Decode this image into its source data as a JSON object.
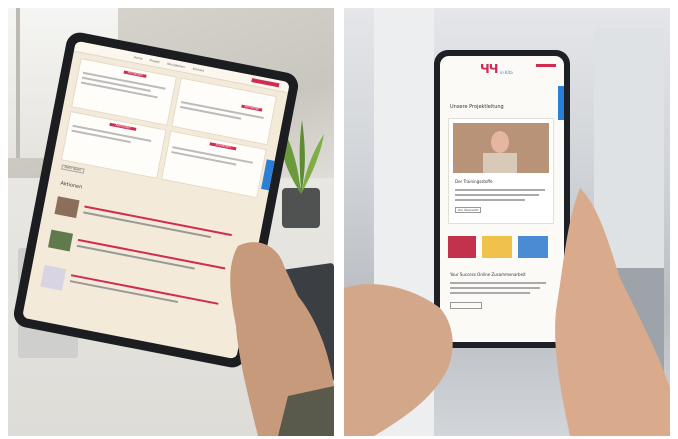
{
  "left_photo": {
    "tablet": {
      "nav_items": [
        "Home",
        "Projekt",
        "Neuigkeiten",
        "Kontakt"
      ],
      "section_title": "Aktionen",
      "card_buttons": [
        "Anmelden",
        "Anmelden",
        "Anmelden",
        "Anmelden"
      ],
      "more_button": "Mehr lesen"
    }
  },
  "right_photo": {
    "phone": {
      "logo_text": "ЧЧ",
      "logo_subtitle": "in Kita",
      "heading": "Unsere Projektleitung",
      "card_title": "Der Trainingsstoffe",
      "button_label": "Zur Übersicht",
      "section2_title": "Your Success Online Zusammenarbeit"
    }
  },
  "colors": {
    "brand_red": "#d12b52",
    "accent_blue": "#2a7fd6",
    "device_dark": "#1b1d20"
  }
}
